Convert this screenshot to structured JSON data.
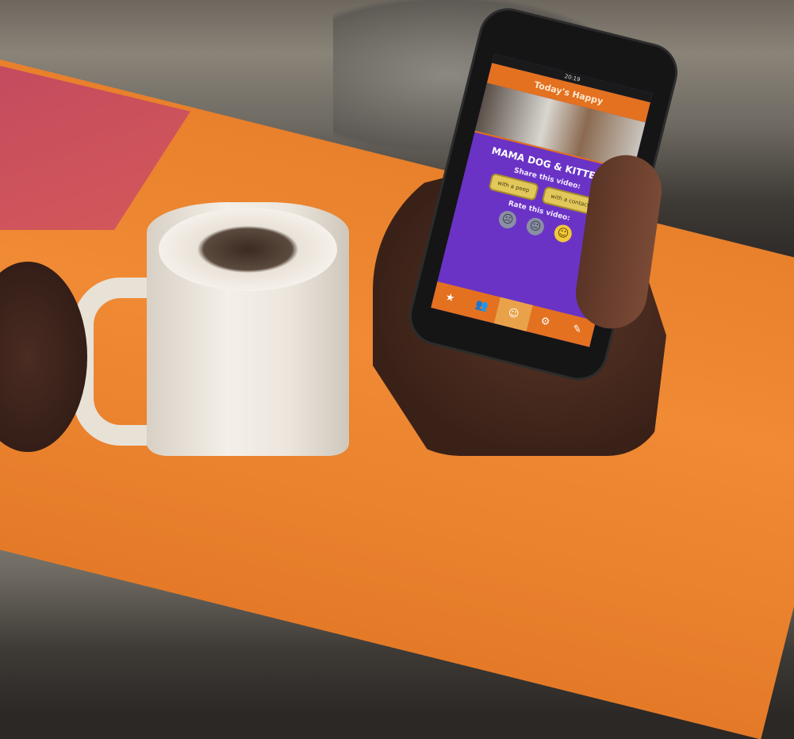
{
  "phone_app": {
    "status_time": "20:19",
    "nav_title": "Today's Happy",
    "video_title": "MAMA DOG & KITTENS",
    "share_label": "Share this video:",
    "share_buttons": [
      "with a peep",
      "with a contact"
    ],
    "rate_label": "Rate this video:",
    "rating_faces": [
      "neutral-face-icon",
      "neutral-face-icon",
      "happy-face-icon"
    ],
    "tabs": [
      {
        "icon": "star-icon",
        "glyph": "★"
      },
      {
        "icon": "people-icon",
        "glyph": "👥"
      },
      {
        "icon": "smiley-icon",
        "glyph": "☺"
      },
      {
        "icon": "badge-icon",
        "glyph": "⚙"
      },
      {
        "icon": "pencil-icon",
        "glyph": "✎"
      }
    ],
    "colors": {
      "accent": "#e3711f",
      "background": "#6a33c6",
      "button": "#e2c85a"
    }
  }
}
